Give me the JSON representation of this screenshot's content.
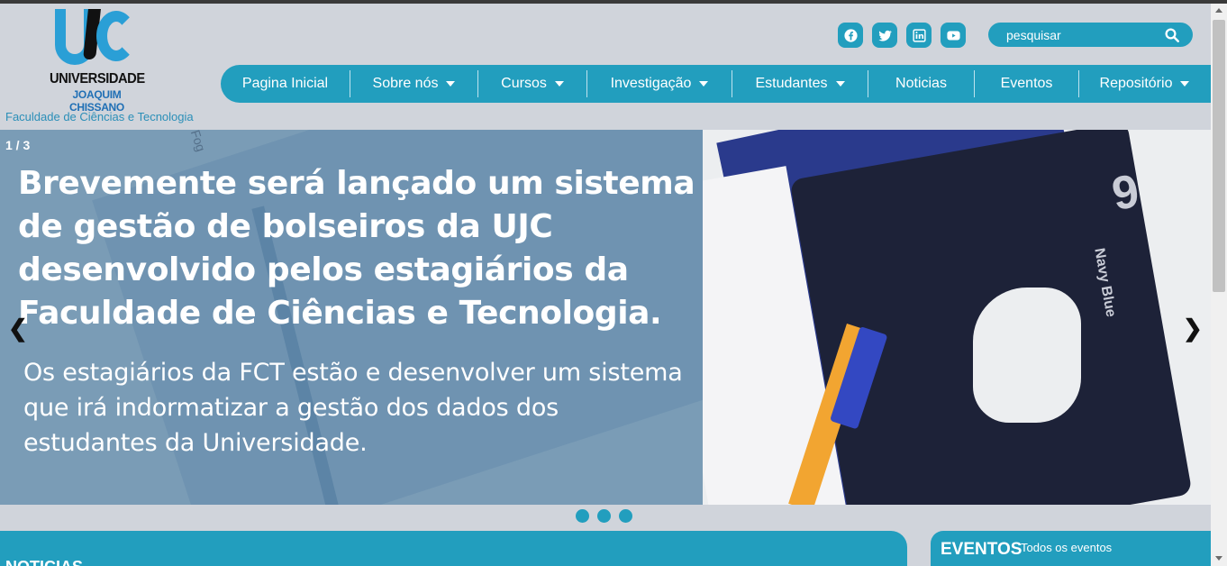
{
  "brand": {
    "logo_name": "UNIVERSIDADE",
    "logo_sub": "JOAQUIM CHISSANO",
    "faculty": "Faculdade de Ciências e Tecnologia"
  },
  "social": [
    "facebook-icon",
    "twitter-icon",
    "linkedin-icon",
    "youtube-icon"
  ],
  "search": {
    "placeholder": "pesquisar"
  },
  "nav": {
    "items": [
      {
        "label": "Pagina Inicial",
        "dropdown": false
      },
      {
        "label": "Sobre nós",
        "dropdown": true
      },
      {
        "label": "Cursos",
        "dropdown": true
      },
      {
        "label": "Investigação",
        "dropdown": true
      },
      {
        "label": "Estudantes",
        "dropdown": true
      },
      {
        "label": "Noticias",
        "dropdown": false
      },
      {
        "label": "Eventos",
        "dropdown": false
      },
      {
        "label": "Repositório",
        "dropdown": true
      }
    ]
  },
  "slider": {
    "counter": "1 / 3",
    "title": "Brevemente será lançado um sistema de gestão de bolseiros da UJC desenvolvido pelos estagiários da Faculdade de Ciências e Tecnologia.",
    "text": "Os estagiários da FCT estão e desenvolver um sistema que irá indormatizar a gestão dos dados dos estudantes da Universidade.",
    "prev": "❮",
    "next": "❯",
    "image_text": {
      "fog": "Fog",
      "number": "9",
      "label": "Navy Blue"
    },
    "dots": 3
  },
  "news": {
    "title": "NOTICIAS"
  },
  "events": {
    "title": "EVENTOS",
    "link": "Todos os eventos"
  },
  "colors": {
    "accent": "#229ebe",
    "background": "#d0d4db",
    "hero_overlay": "#7a9cb6"
  }
}
